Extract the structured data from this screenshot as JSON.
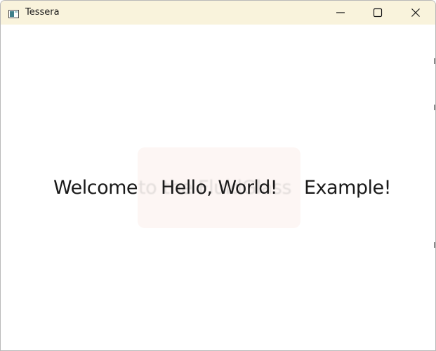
{
  "window": {
    "title": "Tessera",
    "app_icon": "app-window-icon",
    "controls": {
      "minimize_icon": "minimize-icon",
      "maximize_icon": "maximize-icon",
      "close_icon": "close-icon"
    },
    "titlebar_color": "#f9f3dc"
  },
  "main": {
    "welcome_text": "Welcome",
    "blurred_text": "to the FluidGlass",
    "hello_text": "Hello, World!",
    "example_text": "Example!",
    "glass_panel_color": "#fdf6f4",
    "text_color": "#1a1a1a"
  }
}
